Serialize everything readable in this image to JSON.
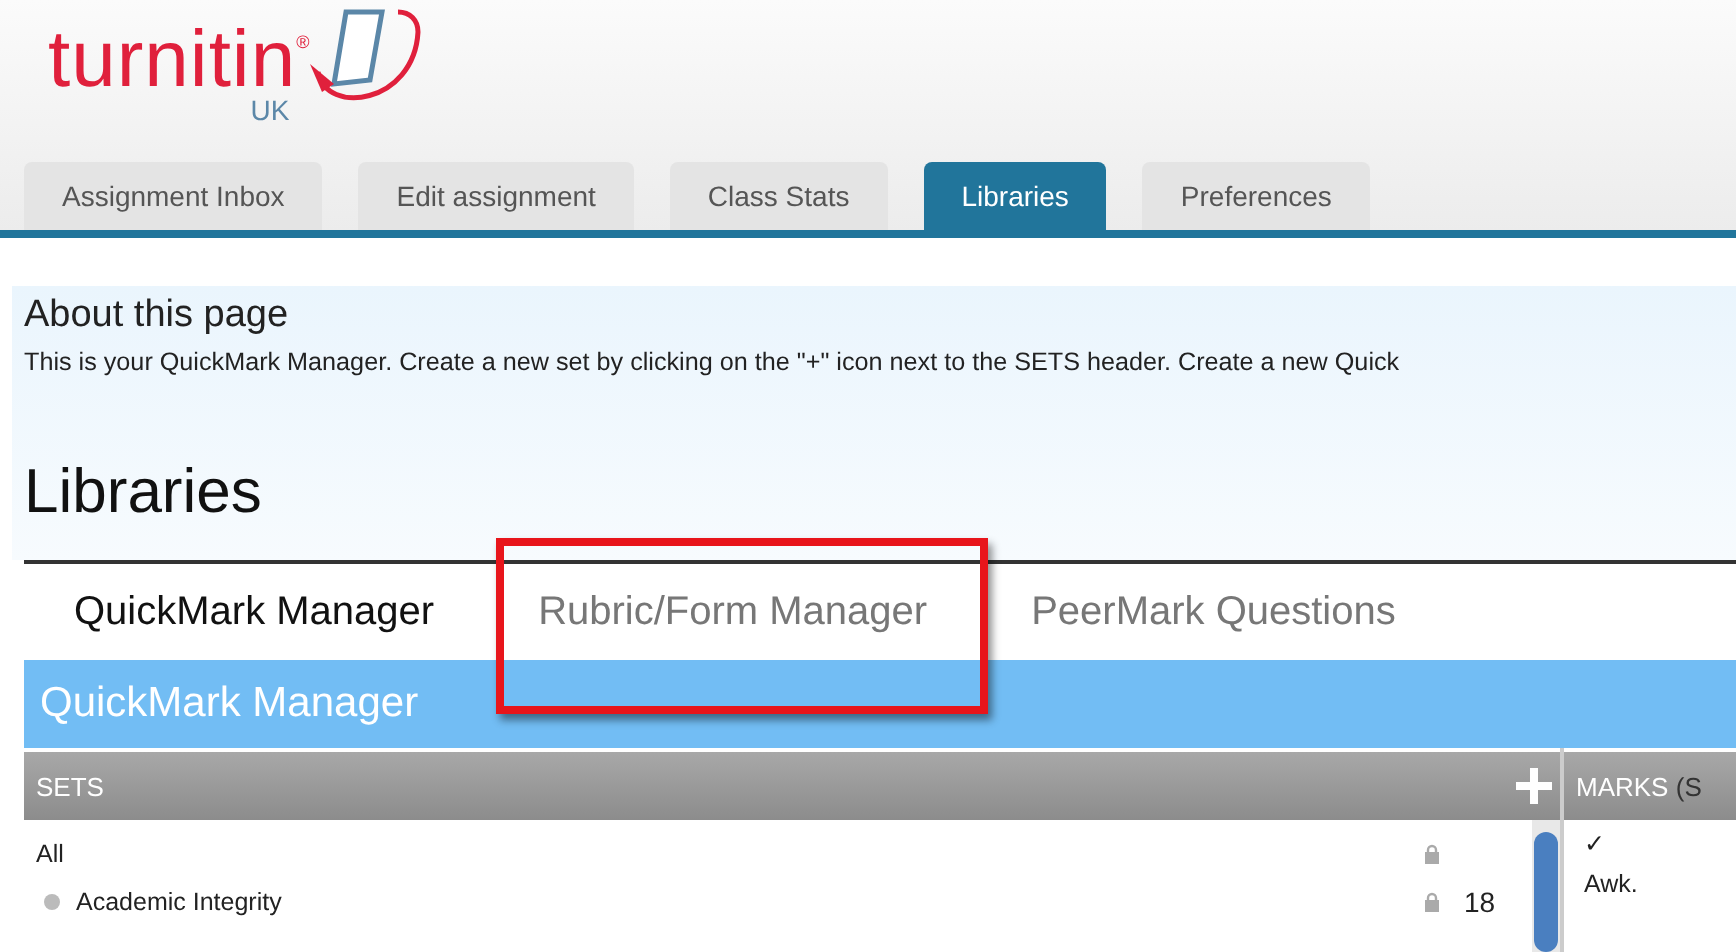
{
  "logo": {
    "name": "turnitin",
    "mark": "®",
    "region": "UK"
  },
  "tabs": [
    {
      "label": "Assignment Inbox",
      "selected": false
    },
    {
      "label": "Edit assignment",
      "selected": false
    },
    {
      "label": "Class Stats",
      "selected": false
    },
    {
      "label": "Libraries",
      "selected": true
    },
    {
      "label": "Preferences",
      "selected": false
    }
  ],
  "about": {
    "title": "About this page",
    "text": "This is your QuickMark Manager. Create a new set by clicking on the \"+\" icon next to the SETS header. Create a new Quick"
  },
  "heading": "Libraries",
  "library_tabs": [
    {
      "label": "QuickMark Manager",
      "selected": true,
      "highlighted": false
    },
    {
      "label": "Rubric/Form Manager",
      "selected": false,
      "highlighted": true
    },
    {
      "label": "PeerMark Questions",
      "selected": false,
      "highlighted": false
    }
  ],
  "panel": {
    "title": "QuickMark Manager",
    "sets_header": "SETS",
    "marks_header": "MARKS",
    "marks_note": "(S",
    "sets": [
      {
        "kind": "all",
        "name": "All",
        "locked": true
      },
      {
        "kind": "set",
        "name": "Academic Integrity",
        "locked": true,
        "count": "18"
      }
    ],
    "marks": [
      "✓",
      "Awk."
    ]
  }
}
